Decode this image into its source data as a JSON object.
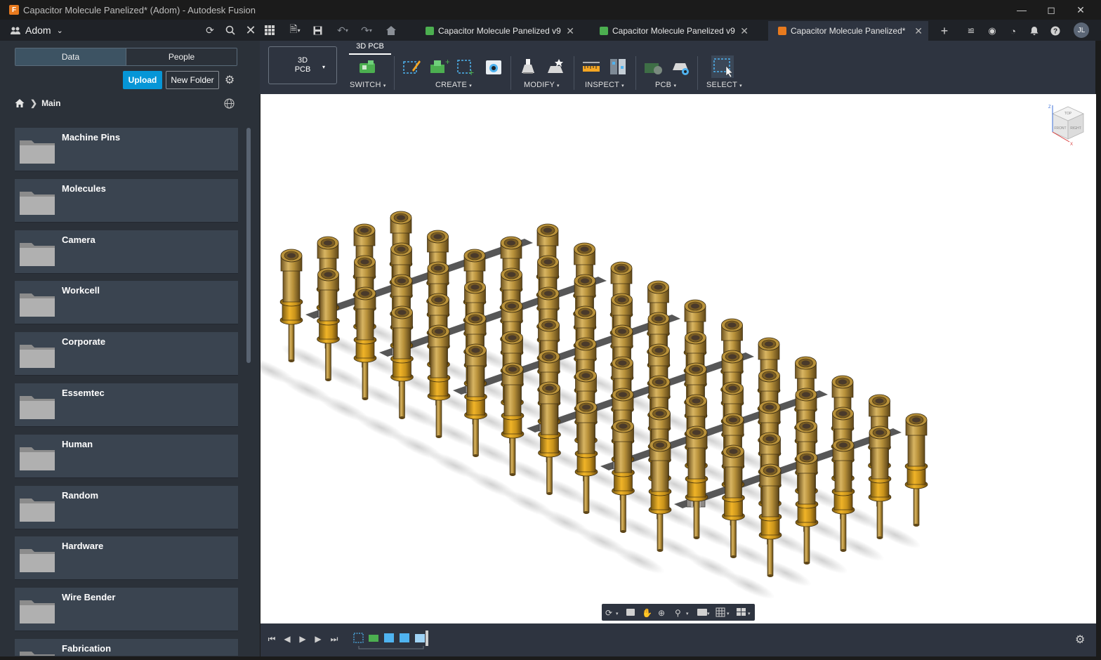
{
  "window": {
    "title": "Capacitor Molecule Panelized* (Adom) - Autodesk Fusion",
    "app_icon_letter": "F"
  },
  "appbar": {
    "team_name": "Adom",
    "tabs": [
      {
        "label": "Capacitor Molecule Panelized v9",
        "icon_color": "#4caf50",
        "active": false
      },
      {
        "label": "Capacitor Molecule Panelized v9",
        "icon_color": "#4caf50",
        "active": false
      },
      {
        "label": "Capacitor Molecule Panelized*",
        "icon_color": "#e87a1e",
        "active": true
      }
    ],
    "avatar_initials": "JL"
  },
  "data_panel": {
    "tab_data": "Data",
    "tab_people": "People",
    "upload_label": "Upload",
    "new_folder_label": "New Folder",
    "breadcrumb_current": "Main",
    "folders": [
      {
        "name": "Machine Pins"
      },
      {
        "name": "Molecules"
      },
      {
        "name": "Camera"
      },
      {
        "name": "Workcell"
      },
      {
        "name": "Corporate"
      },
      {
        "name": "Essemtec"
      },
      {
        "name": "Human"
      },
      {
        "name": "Random"
      },
      {
        "name": "Hardware"
      },
      {
        "name": "Wire Bender"
      },
      {
        "name": "Fabrication"
      }
    ]
  },
  "toolbar": {
    "workspace_line1": "3D",
    "workspace_line2": "PCB",
    "active_tab": "3D PCB",
    "groups": {
      "switch": "SWITCH",
      "create": "CREATE",
      "modify": "MODIFY",
      "inspect": "INSPECT",
      "pcb": "PCB",
      "select": "SELECT"
    }
  },
  "viewcube": {
    "top": "TOP",
    "front": "FRONT",
    "right": "RIGHT",
    "axis_z": "Z",
    "axis_x": "X"
  },
  "colors": {
    "accent": "#0696d7",
    "panel_bg": "#2b3139",
    "folder_bg": "#3a4450",
    "pin_gold": "#b8913a",
    "viewport_bg": "#ffffff"
  }
}
